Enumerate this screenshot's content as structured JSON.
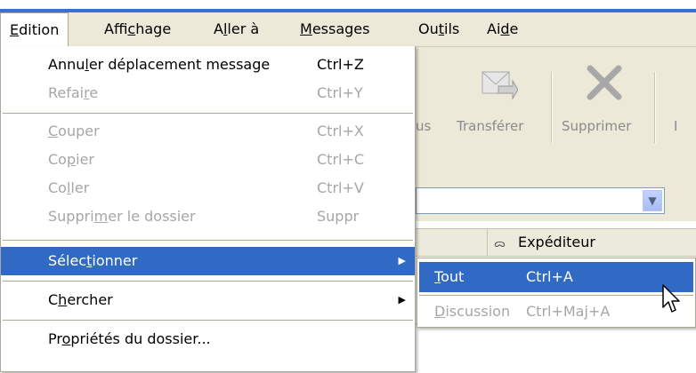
{
  "menubar": {
    "items": [
      {
        "label": "Edition",
        "key": "E"
      },
      {
        "label": "Affichage",
        "key": "c"
      },
      {
        "label": "Aller à",
        "key": "l"
      },
      {
        "label": "Messages",
        "key": "M"
      },
      {
        "label": "Outils",
        "key": "t"
      },
      {
        "label": "Aide",
        "key": "d"
      }
    ]
  },
  "toolbar": {
    "partial_label": "us",
    "forward_label": "Transférer",
    "delete_label": "Supprimer",
    "cut_label": "I"
  },
  "header": {
    "sender_col": "Expéditeur"
  },
  "edit_menu": {
    "items": [
      {
        "pre": "Annu",
        "key": "l",
        "post": "er déplacement message",
        "shortcut": "Ctrl+Z",
        "enabled": true
      },
      {
        "pre": "Refai",
        "key": "r",
        "post": "e",
        "shortcut": "Ctrl+Y",
        "enabled": false
      },
      {
        "pre": "",
        "key": "C",
        "post": "ouper",
        "shortcut": "Ctrl+X",
        "enabled": false
      },
      {
        "pre": "Co",
        "key": "p",
        "post": "ier",
        "shortcut": "Ctrl+C",
        "enabled": false
      },
      {
        "pre": "Co",
        "key": "l",
        "post": "ler",
        "shortcut": "Ctrl+V",
        "enabled": false
      },
      {
        "pre": "Suppri",
        "key": "m",
        "post": "er le dossier",
        "shortcut": "Suppr",
        "enabled": false
      },
      {
        "pre": "Sélec",
        "key": "t",
        "post": "ionner",
        "shortcut": "",
        "enabled": true,
        "submenu": true
      },
      {
        "pre": "C",
        "key": "h",
        "post": "ercher",
        "shortcut": "",
        "enabled": true,
        "submenu": true
      },
      {
        "pre": "Pr",
        "key": "o",
        "post": "priétés du dossier...",
        "shortcut": "",
        "enabled": true
      }
    ]
  },
  "select_submenu": {
    "items": [
      {
        "pre": "",
        "key": "T",
        "post": "out",
        "shortcut": "Ctrl+A",
        "enabled": true
      },
      {
        "pre": "",
        "key": "D",
        "post": "iscussion",
        "shortcut": "Ctrl+Maj+A",
        "enabled": false
      }
    ]
  },
  "colors": {
    "highlight": "#316ac5",
    "menubar": "#ece9d8",
    "disabled": "#a6a6a6",
    "title_blue": "#3a6fd6"
  }
}
